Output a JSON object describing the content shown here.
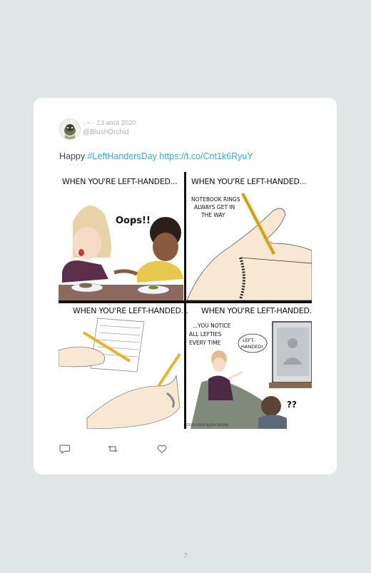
{
  "tweet": {
    "meta": ". ~ · 13 août 2020",
    "handle": "@BlushOrchid",
    "text_prefix": "Happy ",
    "hashtag": "#LeftHandersDay",
    "link": "https://t.co/Cnt1k6RyuY"
  },
  "comic": {
    "panels": [
      {
        "title": "WHEN YOU'RE LEFT-HANDED...",
        "speech": "Oops!!"
      },
      {
        "title": "WHEN YOU'RE LEFT-HANDED...",
        "caption_lines": [
          "NOTEBOOK RINGS",
          "ALWAYS GET IN",
          "THE WAY"
        ]
      },
      {
        "title": "WHEN YOU'RE LEFT-HANDED..."
      },
      {
        "title": "WHEN YOU'RE LEFT-HANDED...",
        "caption_lines": [
          "...YOU NOTICE",
          "ALL LEFTIES",
          "EVERY TIME"
        ],
        "bubble_lines": [
          "LEFT-",
          "HANDED!"
        ],
        "question": "??",
        "credit": "STEPH HOOK BLUSH ORCHID"
      }
    ]
  },
  "actions": {
    "reply": "reply-icon",
    "retweet": "retweet-icon",
    "like": "heart-icon"
  },
  "page_number": "7",
  "colors": {
    "background": "#dfe7e6",
    "card": "#ffffff",
    "link": "#3aa7e8",
    "muted": "#a8b3b3"
  }
}
